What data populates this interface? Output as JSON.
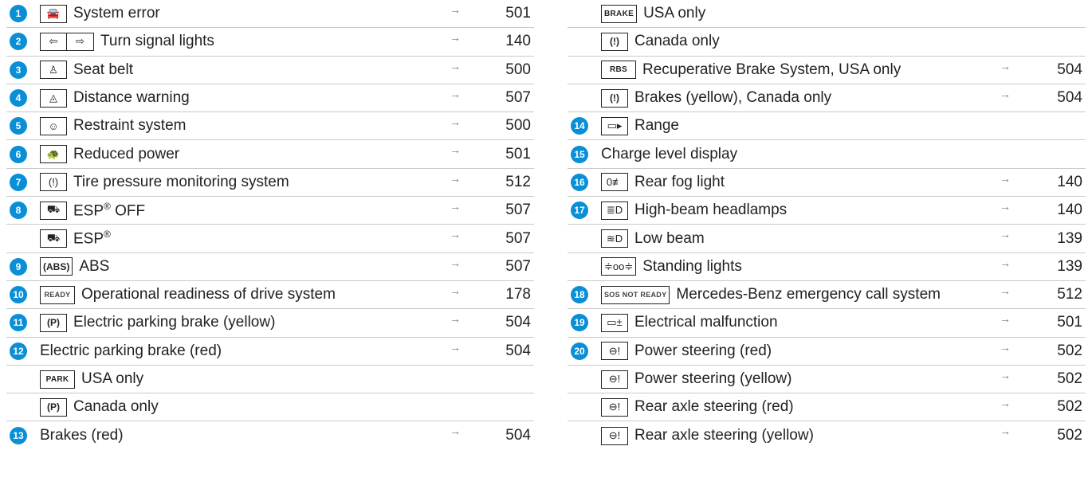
{
  "left_rows": [
    {
      "num": "1",
      "icons": [
        "car-icon"
      ],
      "label": "System error",
      "page": "501"
    },
    {
      "num": "2",
      "icons": [
        "left-arrow-icon",
        "right-arrow-icon"
      ],
      "label": "Turn signal lights",
      "page": "140"
    },
    {
      "num": "3",
      "icons": [
        "seat-belt-icon"
      ],
      "label": "Seat belt",
      "page": "500"
    },
    {
      "num": "4",
      "icons": [
        "distance-warning-icon"
      ],
      "label": "Distance warning",
      "page": "507"
    },
    {
      "num": "5",
      "icons": [
        "airbag-icon"
      ],
      "label": "Restraint system",
      "page": "500"
    },
    {
      "num": "6",
      "icons": [
        "turtle-icon"
      ],
      "label": "Reduced power",
      "page": "501"
    },
    {
      "num": "7",
      "icons": [
        "tire-pressure-icon"
      ],
      "label": "Tire pressure monitoring system",
      "page": "512"
    },
    {
      "num": "8",
      "icons": [
        "esp-off-icon"
      ],
      "label": "ESP® OFF",
      "page": "507"
    },
    {
      "num": "",
      "icons": [
        "esp-icon"
      ],
      "label": "ESP®",
      "page": "507"
    },
    {
      "num": "9",
      "icons": [
        "abs-icon"
      ],
      "label": "ABS",
      "page": "507"
    },
    {
      "num": "10",
      "icons": [
        "ready-icon"
      ],
      "label": "Operational readiness of drive system",
      "page": "178"
    },
    {
      "num": "11",
      "icons": [
        "parking-brake-icon"
      ],
      "label": "Electric parking brake (yellow)",
      "page": "504"
    },
    {
      "num": "12",
      "icons": [],
      "label": "Electric parking brake (red)",
      "page": "504"
    },
    {
      "num": "",
      "icons": [
        "park-icon"
      ],
      "label": "USA only",
      "page": ""
    },
    {
      "num": "",
      "icons": [
        "parking-brake-icon"
      ],
      "label": "Canada only",
      "page": ""
    },
    {
      "num": "13",
      "icons": [],
      "label": "Brakes (red)",
      "page": "504"
    }
  ],
  "right_rows": [
    {
      "num": "",
      "icons": [
        "brake-icon"
      ],
      "label": "USA only",
      "page": ""
    },
    {
      "num": "",
      "icons": [
        "brake-warning-icon"
      ],
      "label": "Canada only",
      "page": ""
    },
    {
      "num": "",
      "icons": [
        "rbs-icon"
      ],
      "label": "Recuperative Brake System, USA only",
      "page": "504"
    },
    {
      "num": "",
      "icons": [
        "brake-warning-icon"
      ],
      "label": "Brakes (yellow), Canada only",
      "page": "504"
    },
    {
      "num": "14",
      "icons": [
        "battery-range-icon"
      ],
      "label": "Range",
      "page": ""
    },
    {
      "num": "15",
      "icons": [],
      "label": "Charge level display",
      "page": ""
    },
    {
      "num": "16",
      "icons": [
        "rear-fog-icon"
      ],
      "label": "Rear fog light",
      "page": "140"
    },
    {
      "num": "17",
      "icons": [
        "high-beam-icon"
      ],
      "label": "High-beam headlamps",
      "page": "140"
    },
    {
      "num": "",
      "icons": [
        "low-beam-icon"
      ],
      "label": "Low beam",
      "page": "139"
    },
    {
      "num": "",
      "icons": [
        "standing-lights-icon"
      ],
      "label": "Standing lights",
      "page": "139"
    },
    {
      "num": "18",
      "icons": [
        "sos-not-ready-icon"
      ],
      "label": "Mercedes-Benz emergency call system",
      "page": "512"
    },
    {
      "num": "19",
      "icons": [
        "battery-icon"
      ],
      "label": "Electrical malfunction",
      "page": "501"
    },
    {
      "num": "20",
      "icons": [
        "steering-icon"
      ],
      "label": "Power steering (red)",
      "page": "502"
    },
    {
      "num": "",
      "icons": [
        "steering-icon"
      ],
      "label": "Power steering (yellow)",
      "page": "502"
    },
    {
      "num": "",
      "icons": [
        "steering-icon"
      ],
      "label": "Rear axle steering (red)",
      "page": "502"
    },
    {
      "num": "",
      "icons": [
        "steering-icon"
      ],
      "label": "Rear axle steering (yellow)",
      "page": "502"
    }
  ],
  "icon_text": {
    "ready-icon": "READY",
    "park-icon": "PARK",
    "brake-icon": "BRAKE",
    "rbs-icon": "RBS",
    "sos-not-ready-icon": "SOS NOT READY"
  },
  "arrow_symbol": "→",
  "accent_color": "#0a8fd6"
}
